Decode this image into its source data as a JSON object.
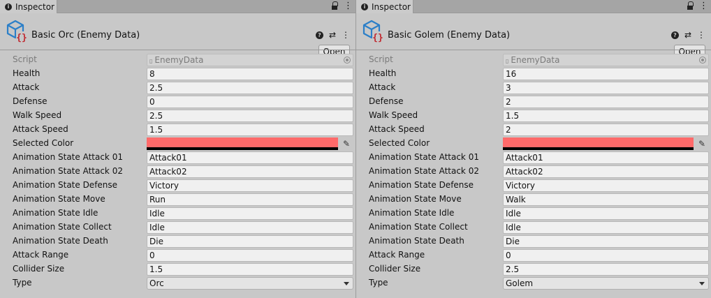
{
  "swatch_color": "#ff6a6a",
  "icons": {
    "tab": "info-icon",
    "lock": "lock-icon",
    "kebab": "kebab-icon",
    "help": "help-icon",
    "preset": "presets-icon",
    "eyedropper": "eyedropper-icon",
    "script_asset": "script-asset-icon"
  },
  "panels": [
    {
      "tab_label": "Inspector",
      "title": "Basic Orc (Enemy Data)",
      "open_label": "Open",
      "help_glyph": "?",
      "presets_glyph": "⇄",
      "menu_glyph": "⋮",
      "script_label": "Script",
      "script_value": "EnemyData",
      "labels": {
        "health": "Health",
        "attack": "Attack",
        "defense": "Defense",
        "walk_speed": "Walk Speed",
        "attack_speed": "Attack Speed",
        "selected_color": "Selected Color",
        "anim_attack01": "Animation State Attack 01",
        "anim_attack02": "Animation State Attack 02",
        "anim_defense": "Animation State Defense",
        "anim_move": "Animation State Move",
        "anim_idle": "Animation State Idle",
        "anim_collect": "Animation State Collect",
        "anim_death": "Animation State Death",
        "attack_range": "Attack Range",
        "collider_size": "Collider Size",
        "type": "Type"
      },
      "values": {
        "health": "8",
        "attack": "2.5",
        "defense": "0",
        "walk_speed": "2.5",
        "attack_speed": "1.5",
        "anim_attack01": "Attack01",
        "anim_attack02": "Attack02",
        "anim_defense": "Victory",
        "anim_move": "Run",
        "anim_idle": "Idle",
        "anim_collect": "Idle",
        "anim_death": "Die",
        "attack_range": "0",
        "collider_size": "1.5",
        "type": "Orc"
      }
    },
    {
      "tab_label": "Inspector",
      "title": "Basic Golem (Enemy Data)",
      "open_label": "Open",
      "help_glyph": "?",
      "presets_glyph": "⇄",
      "menu_glyph": "⋮",
      "script_label": "Script",
      "script_value": "EnemyData",
      "labels": {
        "health": "Health",
        "attack": "Attack",
        "defense": "Defense",
        "walk_speed": "Walk Speed",
        "attack_speed": "Attack Speed",
        "selected_color": "Selected Color",
        "anim_attack01": "Animation State Attack 01",
        "anim_attack02": "Animation State Attack 02",
        "anim_defense": "Animation State Defense",
        "anim_move": "Animation State Move",
        "anim_idle": "Animation State Idle",
        "anim_collect": "Animation State Collect",
        "anim_death": "Animation State Death",
        "attack_range": "Attack Range",
        "collider_size": "Collider Size",
        "type": "Type"
      },
      "values": {
        "health": "16",
        "attack": "3",
        "defense": "2",
        "walk_speed": "1.5",
        "attack_speed": "2",
        "anim_attack01": "Attack01",
        "anim_attack02": "Attack02",
        "anim_defense": "Victory",
        "anim_move": "Walk",
        "anim_idle": "Idle",
        "anim_collect": "Idle",
        "anim_death": "Die",
        "attack_range": "0",
        "collider_size": "2.5",
        "type": "Golem"
      }
    }
  ]
}
